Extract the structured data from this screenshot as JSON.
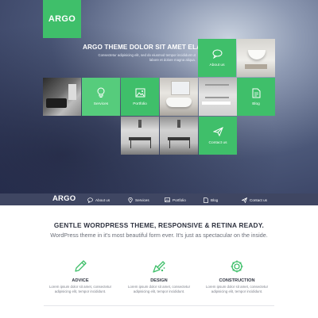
{
  "hero": {
    "logo": "ARGO",
    "headline": "ARGO THEME DOLOR SIT AMET ELASDE",
    "subline": "Consectetur adipisicing elit, sed do eiusmod tempor incididunt ut labore et dolore magna aliqua.",
    "tiles": {
      "about": "About us",
      "services": "Services",
      "portfolio": "Portfolio",
      "blog": "Blog",
      "contact": "Contact us"
    }
  },
  "nav": {
    "logo": "ARGO",
    "items": [
      {
        "label": "About us",
        "icon": "chat-icon"
      },
      {
        "label": "Services",
        "icon": "location-pin-icon"
      },
      {
        "label": "Portfolio",
        "icon": "image-icon"
      },
      {
        "label": "Blog",
        "icon": "document-icon"
      },
      {
        "label": "Contact us",
        "icon": "paper-plane-icon"
      }
    ]
  },
  "main": {
    "tagline": "GENTLE WORDPRESS THEME, RESPONSIVE & RETINA READY.",
    "subtext": "WordPress theme in it's most beautiful form ever. It's just as spectacular on the inside.",
    "features": [
      {
        "title": "ADVICE",
        "desc": "Lorem ipsum dolor sit amet, consectetur adipisicing elit, tempor incididunt.",
        "icon": "pencil-icon"
      },
      {
        "title": "DESIGN",
        "desc": "Lorem ipsum dolor sit amet, consectetur adipisicing elit, tempor incididunt.",
        "icon": "brush-icon"
      },
      {
        "title": "CONSTRUCTION",
        "desc": "Lorem ipsum dolor sit amet, consectetur adipisicing elit, tempor incididunt.",
        "icon": "gear-icon"
      }
    ]
  },
  "colors": {
    "accent": "#3fbf6a",
    "navbar": "#3f4662",
    "heading": "#2f3340"
  }
}
